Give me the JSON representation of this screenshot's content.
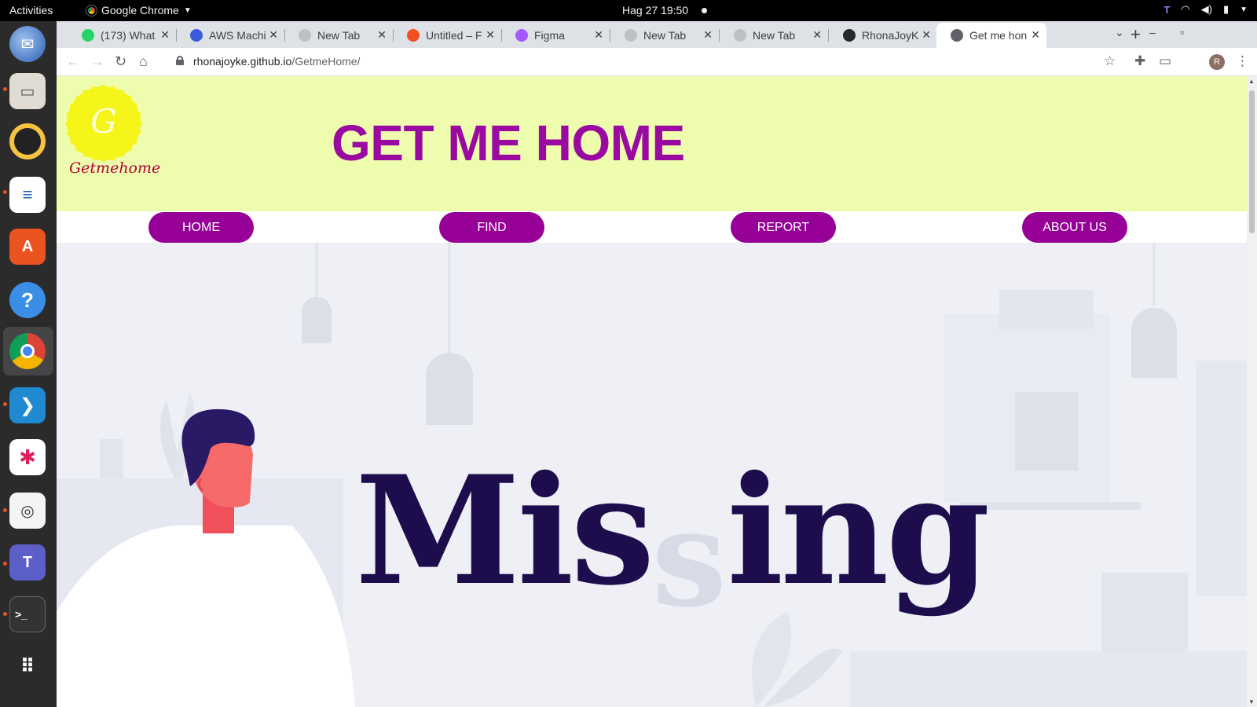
{
  "system": {
    "activities": "Activities",
    "app_menu": "Google Chrome",
    "clock": "Hag 27  19:50"
  },
  "browser": {
    "tabs": [
      {
        "title": "(173) What",
        "favicon": "whatsapp-icon",
        "color": "#25d366"
      },
      {
        "title": "AWS Machi",
        "favicon": "udemy-icon",
        "color": "#3b5bdb"
      },
      {
        "title": "New Tab",
        "favicon": "chrome-icon",
        "color": "#bdc1c6"
      },
      {
        "title": "Untitled – F",
        "favicon": "figma-icon",
        "color": "#f24e1e"
      },
      {
        "title": "Figma",
        "favicon": "figma-icon",
        "color": "#a259ff"
      },
      {
        "title": "New Tab",
        "favicon": "chrome-icon",
        "color": "#bdc1c6"
      },
      {
        "title": "New Tab",
        "favicon": "chrome-icon",
        "color": "#bdc1c6"
      },
      {
        "title": "RhonaJoyK",
        "favicon": "github-icon",
        "color": "#24292e"
      },
      {
        "title": "Get me hon",
        "favicon": "globe-icon",
        "color": "#5f6368",
        "active": true
      }
    ],
    "url_host": "rhonajoyke.github.io",
    "url_path": "/GetmeHome/",
    "profile_initial": "R"
  },
  "site": {
    "logo_letter": "G",
    "logo_text": "Getmehome",
    "title": "GET ME HOME",
    "nav": [
      "HOME",
      "FIND",
      "REPORT",
      "ABOUT US"
    ],
    "hero_word_left": "Mis",
    "hero_word_ghost": "s",
    "hero_word_right": "ing",
    "colors": {
      "header_bg": "#eefcae",
      "title": "#9a0aa1",
      "pill": "#960096",
      "hero_text": "#1e0d4d"
    }
  }
}
